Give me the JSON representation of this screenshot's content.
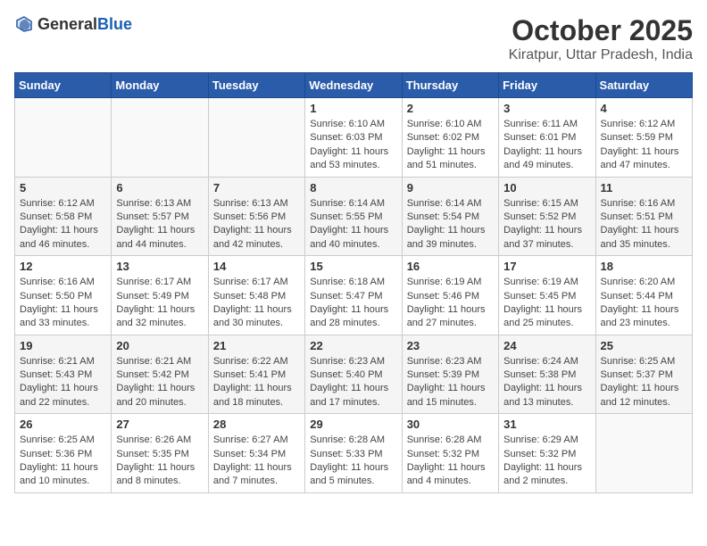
{
  "header": {
    "logo_general": "General",
    "logo_blue": "Blue",
    "month": "October 2025",
    "location": "Kiratpur, Uttar Pradesh, India"
  },
  "weekdays": [
    "Sunday",
    "Monday",
    "Tuesday",
    "Wednesday",
    "Thursday",
    "Friday",
    "Saturday"
  ],
  "weeks": [
    [
      {
        "day": "",
        "info": ""
      },
      {
        "day": "",
        "info": ""
      },
      {
        "day": "",
        "info": ""
      },
      {
        "day": "1",
        "info": "Sunrise: 6:10 AM\nSunset: 6:03 PM\nDaylight: 11 hours\nand 53 minutes."
      },
      {
        "day": "2",
        "info": "Sunrise: 6:10 AM\nSunset: 6:02 PM\nDaylight: 11 hours\nand 51 minutes."
      },
      {
        "day": "3",
        "info": "Sunrise: 6:11 AM\nSunset: 6:01 PM\nDaylight: 11 hours\nand 49 minutes."
      },
      {
        "day": "4",
        "info": "Sunrise: 6:12 AM\nSunset: 5:59 PM\nDaylight: 11 hours\nand 47 minutes."
      }
    ],
    [
      {
        "day": "5",
        "info": "Sunrise: 6:12 AM\nSunset: 5:58 PM\nDaylight: 11 hours\nand 46 minutes."
      },
      {
        "day": "6",
        "info": "Sunrise: 6:13 AM\nSunset: 5:57 PM\nDaylight: 11 hours\nand 44 minutes."
      },
      {
        "day": "7",
        "info": "Sunrise: 6:13 AM\nSunset: 5:56 PM\nDaylight: 11 hours\nand 42 minutes."
      },
      {
        "day": "8",
        "info": "Sunrise: 6:14 AM\nSunset: 5:55 PM\nDaylight: 11 hours\nand 40 minutes."
      },
      {
        "day": "9",
        "info": "Sunrise: 6:14 AM\nSunset: 5:54 PM\nDaylight: 11 hours\nand 39 minutes."
      },
      {
        "day": "10",
        "info": "Sunrise: 6:15 AM\nSunset: 5:52 PM\nDaylight: 11 hours\nand 37 minutes."
      },
      {
        "day": "11",
        "info": "Sunrise: 6:16 AM\nSunset: 5:51 PM\nDaylight: 11 hours\nand 35 minutes."
      }
    ],
    [
      {
        "day": "12",
        "info": "Sunrise: 6:16 AM\nSunset: 5:50 PM\nDaylight: 11 hours\nand 33 minutes."
      },
      {
        "day": "13",
        "info": "Sunrise: 6:17 AM\nSunset: 5:49 PM\nDaylight: 11 hours\nand 32 minutes."
      },
      {
        "day": "14",
        "info": "Sunrise: 6:17 AM\nSunset: 5:48 PM\nDaylight: 11 hours\nand 30 minutes."
      },
      {
        "day": "15",
        "info": "Sunrise: 6:18 AM\nSunset: 5:47 PM\nDaylight: 11 hours\nand 28 minutes."
      },
      {
        "day": "16",
        "info": "Sunrise: 6:19 AM\nSunset: 5:46 PM\nDaylight: 11 hours\nand 27 minutes."
      },
      {
        "day": "17",
        "info": "Sunrise: 6:19 AM\nSunset: 5:45 PM\nDaylight: 11 hours\nand 25 minutes."
      },
      {
        "day": "18",
        "info": "Sunrise: 6:20 AM\nSunset: 5:44 PM\nDaylight: 11 hours\nand 23 minutes."
      }
    ],
    [
      {
        "day": "19",
        "info": "Sunrise: 6:21 AM\nSunset: 5:43 PM\nDaylight: 11 hours\nand 22 minutes."
      },
      {
        "day": "20",
        "info": "Sunrise: 6:21 AM\nSunset: 5:42 PM\nDaylight: 11 hours\nand 20 minutes."
      },
      {
        "day": "21",
        "info": "Sunrise: 6:22 AM\nSunset: 5:41 PM\nDaylight: 11 hours\nand 18 minutes."
      },
      {
        "day": "22",
        "info": "Sunrise: 6:23 AM\nSunset: 5:40 PM\nDaylight: 11 hours\nand 17 minutes."
      },
      {
        "day": "23",
        "info": "Sunrise: 6:23 AM\nSunset: 5:39 PM\nDaylight: 11 hours\nand 15 minutes."
      },
      {
        "day": "24",
        "info": "Sunrise: 6:24 AM\nSunset: 5:38 PM\nDaylight: 11 hours\nand 13 minutes."
      },
      {
        "day": "25",
        "info": "Sunrise: 6:25 AM\nSunset: 5:37 PM\nDaylight: 11 hours\nand 12 minutes."
      }
    ],
    [
      {
        "day": "26",
        "info": "Sunrise: 6:25 AM\nSunset: 5:36 PM\nDaylight: 11 hours\nand 10 minutes."
      },
      {
        "day": "27",
        "info": "Sunrise: 6:26 AM\nSunset: 5:35 PM\nDaylight: 11 hours\nand 8 minutes."
      },
      {
        "day": "28",
        "info": "Sunrise: 6:27 AM\nSunset: 5:34 PM\nDaylight: 11 hours\nand 7 minutes."
      },
      {
        "day": "29",
        "info": "Sunrise: 6:28 AM\nSunset: 5:33 PM\nDaylight: 11 hours\nand 5 minutes."
      },
      {
        "day": "30",
        "info": "Sunrise: 6:28 AM\nSunset: 5:32 PM\nDaylight: 11 hours\nand 4 minutes."
      },
      {
        "day": "31",
        "info": "Sunrise: 6:29 AM\nSunset: 5:32 PM\nDaylight: 11 hours\nand 2 minutes."
      },
      {
        "day": "",
        "info": ""
      }
    ]
  ]
}
